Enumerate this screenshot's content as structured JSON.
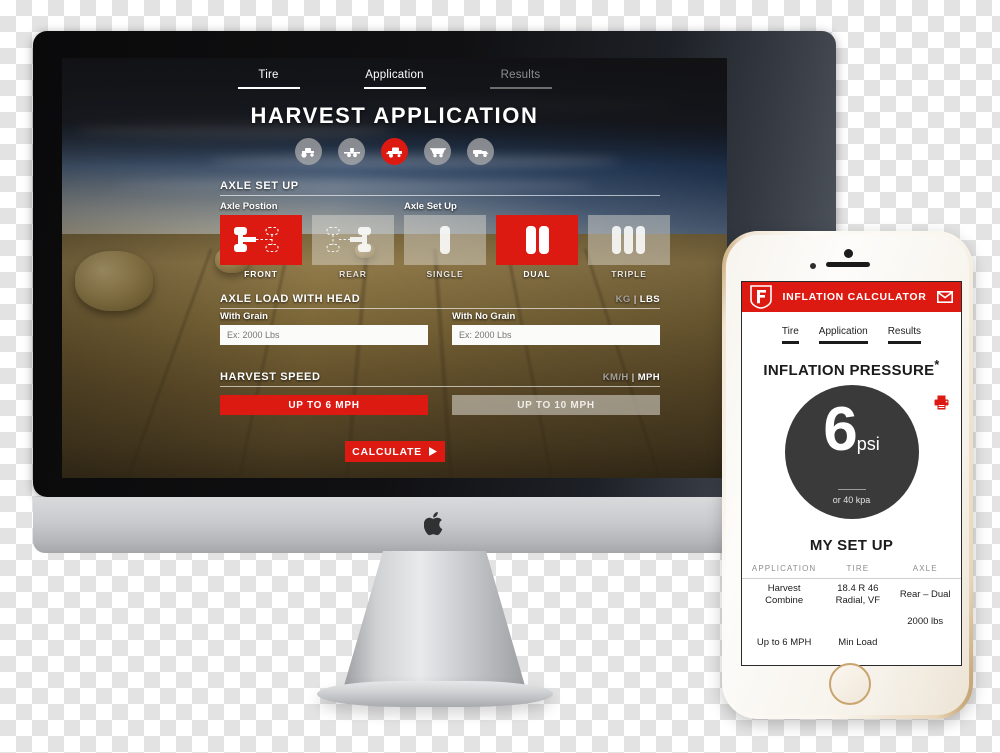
{
  "desktop": {
    "tabs": [
      {
        "label": "Tire",
        "state": "active"
      },
      {
        "label": "Application",
        "state": "active"
      },
      {
        "label": "Results",
        "state": "disabled"
      }
    ],
    "title": "HARVEST APPLICATION",
    "application_icons": [
      {
        "name": "tractor-icon",
        "selected": false
      },
      {
        "name": "sprayer-icon",
        "selected": false
      },
      {
        "name": "combine-icon",
        "selected": true
      },
      {
        "name": "grain-cart-icon",
        "selected": false
      },
      {
        "name": "truck-icon",
        "selected": false
      }
    ],
    "axle_setup": {
      "heading": "AXLE SET UP",
      "position_label": "Axle Postion",
      "setup_label": "Axle Set Up",
      "position_options": [
        {
          "label": "FRONT",
          "selected": true,
          "icon": "axle-front-icon"
        },
        {
          "label": "REAR",
          "selected": false,
          "icon": "axle-rear-icon"
        }
      ],
      "setup_options": [
        {
          "label": "SINGLE",
          "selected": false,
          "icon": "tire-single-icon"
        },
        {
          "label": "DUAL",
          "selected": true,
          "icon": "tire-dual-icon"
        },
        {
          "label": "TRIPLE",
          "selected": false,
          "icon": "tire-triple-icon"
        }
      ]
    },
    "axle_load": {
      "heading": "AXLE LOAD WITH HEAD",
      "unit_kg": "KG",
      "unit_sep": "|",
      "unit_lbs": "LBS",
      "with_grain_label": "With Grain",
      "with_grain_placeholder": "Ex: 2000 Lbs",
      "with_grain_value": "",
      "no_grain_label": "With No Grain",
      "no_grain_placeholder": "Ex: 2000 Lbs",
      "no_grain_value": ""
    },
    "harvest_speed": {
      "heading": "HARVEST SPEED",
      "unit_kmh": "KM/H",
      "unit_sep": "|",
      "unit_mph": "MPH",
      "options": [
        {
          "label": "UP TO 6 MPH",
          "selected": true
        },
        {
          "label": "UP TO 10 MPH",
          "selected": false
        }
      ]
    },
    "calculate_label": "CALCULATE",
    "accent_color": "#dd1a12"
  },
  "phone": {
    "header": {
      "logo": "firestone-f-logo",
      "title": "INFLATION CALCULATOR",
      "mail_icon": "envelope-icon"
    },
    "tabs": [
      {
        "label": "Tire"
      },
      {
        "label": "Application"
      },
      {
        "label": "Results"
      }
    ],
    "results": {
      "heading": "INFLATION PRESSURE",
      "heading_mark": "*",
      "value": "6",
      "unit": "psi",
      "alt_value": "or 40 kpa",
      "print_icon": "printer-icon"
    },
    "setup": {
      "heading": "MY SET UP",
      "columns": [
        "APPLICATION",
        "TIRE",
        "AXLE"
      ],
      "rows": [
        [
          "Harvest\nCombine",
          "18.4 R 46\nRadial, VF",
          "Rear – Dual"
        ],
        [
          "",
          "",
          "2000 lbs"
        ],
        [
          "Up to 6 MPH",
          "Min Load",
          ""
        ]
      ]
    },
    "accent_color": "#dd1a12"
  }
}
